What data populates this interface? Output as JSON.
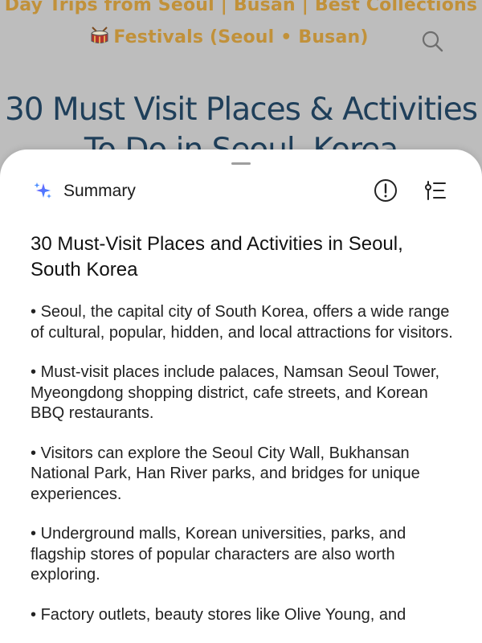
{
  "background_page": {
    "nav_line_1": "Day Trips from Seoul | Busan | Best Collections",
    "nav_line_2": "Festivals (Seoul • Busan)",
    "article_title_line_1": "30 Must Visit Places & Activities",
    "article_title_line_2": "To Do in Seoul, Korea",
    "accent_color": "#c1913a",
    "title_color": "#1f3f5a"
  },
  "sheet": {
    "header": {
      "title": "Summary",
      "icons": [
        "sparkle-icon",
        "info-icon",
        "options-icon"
      ]
    },
    "summary_title": "30 Must-Visit Places and Activities in Seoul, South Korea",
    "bullets": [
      "Seoul, the capital city of South Korea, offers a wide range of cultural, popular, hidden, and local attractions for visitors.",
      "Must-visit places include palaces, Namsan Seoul Tower, Myeongdong shopping district, cafe streets, and Korean BBQ restaurants.",
      "Visitors can explore the Seoul City Wall, Bukhansan National Park, Han River parks, and bridges for unique experiences.",
      "Underground malls, Korean universities, parks, and flagship stores of popular characters are also worth exploring.",
      "Factory outlets, beauty stores like Olive Young, and"
    ]
  }
}
